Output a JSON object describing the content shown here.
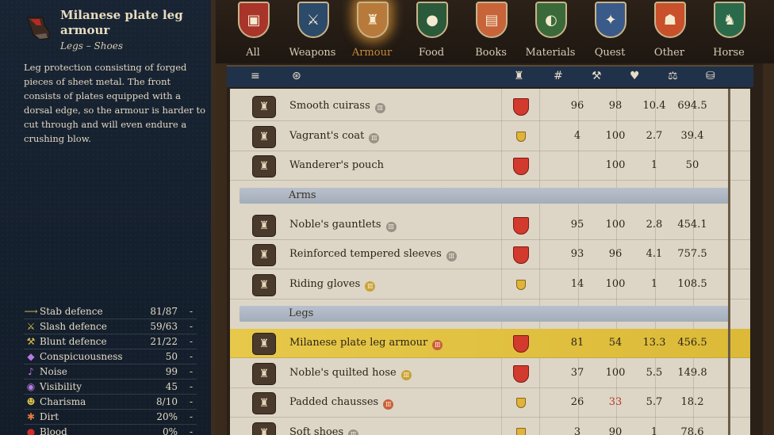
{
  "item": {
    "title": "Milanese plate leg armour",
    "subtitle": "Legs – Shoes",
    "description": "Leg protection consisting of forged pieces of sheet metal. The front consists of plates equipped with a dorsal edge, so the armour is harder to cut through and will even endure a crushing blow."
  },
  "stats": [
    {
      "icon": "stab-icon",
      "glyph": "⟶",
      "label": "Stab defence",
      "value": "81/87",
      "diff": "-"
    },
    {
      "icon": "slash-icon",
      "glyph": "⚔",
      "label": "Slash defence",
      "value": "59/63",
      "diff": "-"
    },
    {
      "icon": "blunt-icon",
      "glyph": "⚒",
      "label": "Blunt defence",
      "value": "21/22",
      "diff": "-"
    },
    {
      "icon": "conspicuousness-icon",
      "glyph": "◆",
      "label": "Conspicuousness",
      "value": "50",
      "diff": "-"
    },
    {
      "icon": "noise-icon",
      "glyph": "♪",
      "label": "Noise",
      "value": "99",
      "diff": "-"
    },
    {
      "icon": "visibility-icon",
      "glyph": "◉",
      "label": "Visibility",
      "value": "45",
      "diff": "-"
    },
    {
      "icon": "charisma-icon",
      "glyph": "☻",
      "label": "Charisma",
      "value": "8/10",
      "diff": "-"
    },
    {
      "icon": "dirt-icon",
      "glyph": "✱",
      "label": "Dirt",
      "value": "20%",
      "diff": "-"
    },
    {
      "icon": "blood-icon",
      "glyph": "●",
      "label": "Blood",
      "value": "0%",
      "diff": "-"
    }
  ],
  "tabs": [
    {
      "label": "All",
      "icon": "all-icon",
      "glyph": "▣",
      "color": "#a8342a",
      "active": false
    },
    {
      "label": "Weapons",
      "icon": "weapons-icon",
      "glyph": "⚔",
      "color": "#2c4a6a",
      "active": false
    },
    {
      "label": "Armour",
      "icon": "armour-icon",
      "glyph": "♜",
      "color": "#b87a3a",
      "active": true
    },
    {
      "label": "Food",
      "icon": "food-icon",
      "glyph": "●",
      "color": "#2a5a3a",
      "active": false
    },
    {
      "label": "Books",
      "icon": "books-icon",
      "glyph": "▤",
      "color": "#c8643a",
      "active": false
    },
    {
      "label": "Materials",
      "icon": "materials-icon",
      "glyph": "◐",
      "color": "#3a6a3a",
      "active": false
    },
    {
      "label": "Quest",
      "icon": "quest-icon",
      "glyph": "✦",
      "color": "#3a5a8a",
      "active": false
    },
    {
      "label": "Other",
      "icon": "other-icon",
      "glyph": "☗",
      "color": "#c8502a",
      "active": false
    },
    {
      "label": "Horse",
      "icon": "horse-icon",
      "glyph": "♞",
      "color": "#2a6a4a",
      "active": false
    }
  ],
  "columns": [
    {
      "name": "sort-icon",
      "glyph": "≡"
    },
    {
      "name": "filter-icon",
      "glyph": "⊛"
    },
    {
      "name": "armour-column-icon",
      "glyph": "♜"
    },
    {
      "name": "count-column-icon",
      "glyph": "#"
    },
    {
      "name": "condition-column-icon",
      "glyph": "⚒"
    },
    {
      "name": "health-column-icon",
      "glyph": "♥"
    },
    {
      "name": "weight-column-icon",
      "glyph": "⚖"
    },
    {
      "name": "price-column-icon",
      "glyph": "⛁"
    }
  ],
  "rows": [
    {
      "type": "item",
      "name": "Smooth cuirass",
      "badge": "gray",
      "shield": "large",
      "c1": "96",
      "c2": "98",
      "c3": "10.4",
      "c4": "694.5"
    },
    {
      "type": "item",
      "name": "Vagrant's coat",
      "badge": "gray",
      "shield": "small",
      "c1": "4",
      "c2": "100",
      "c3": "2.7",
      "c4": "39.4"
    },
    {
      "type": "item",
      "name": "Wanderer's pouch",
      "badge": "",
      "shield": "large",
      "c1": "",
      "c2": "100",
      "c3": "1",
      "c4": "50"
    },
    {
      "type": "section",
      "name": "Arms"
    },
    {
      "type": "item",
      "name": "Noble's gauntlets",
      "badge": "gray",
      "shield": "large",
      "c1": "95",
      "c2": "100",
      "c3": "2.8",
      "c4": "454.1"
    },
    {
      "type": "item",
      "name": "Reinforced tempered sleeves",
      "badge": "gray",
      "shield": "large",
      "c1": "93",
      "c2": "96",
      "c3": "4.1",
      "c4": "757.5"
    },
    {
      "type": "item",
      "name": "Riding gloves",
      "badge": "gold",
      "shield": "small",
      "c1": "14",
      "c2": "100",
      "c3": "1",
      "c4": "108.5"
    },
    {
      "type": "section",
      "name": "Legs"
    },
    {
      "type": "item",
      "name": "Milanese plate leg armour",
      "badge": "orange",
      "shield": "large",
      "c1": "81",
      "c2": "54",
      "c3": "13.3",
      "c4": "456.5",
      "selected": true
    },
    {
      "type": "item",
      "name": "Noble's quilted hose",
      "badge": "gold",
      "shield": "large",
      "c1": "37",
      "c2": "100",
      "c3": "5.5",
      "c4": "149.8"
    },
    {
      "type": "item",
      "name": "Padded chausses",
      "badge": "orange",
      "shield": "small",
      "c1": "26",
      "c2": "33",
      "c2_red": true,
      "c3": "5.7",
      "c4": "18.2"
    },
    {
      "type": "item",
      "name": "Soft shoes",
      "badge": "gray",
      "shield": "small",
      "c1": "3",
      "c2": "90",
      "c3": "1",
      "c4": "78.6"
    }
  ]
}
